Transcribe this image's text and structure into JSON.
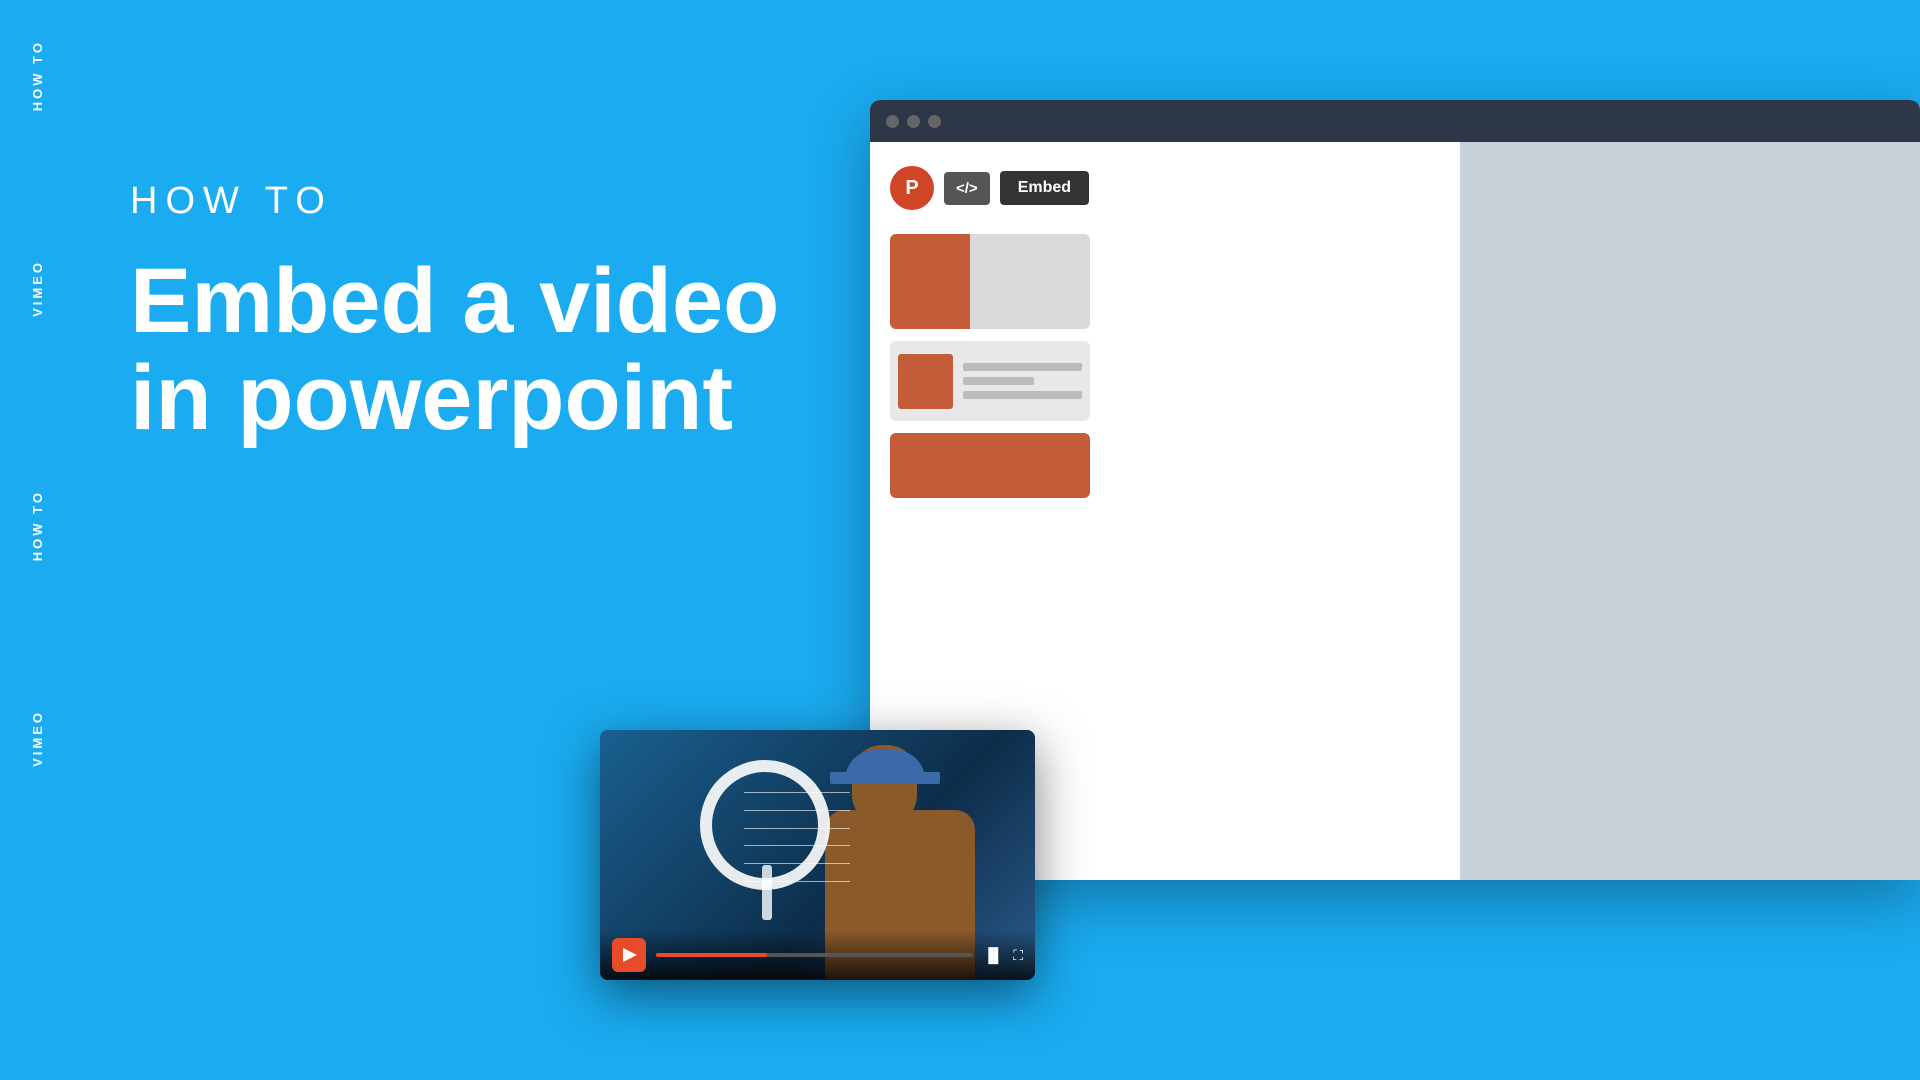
{
  "background_color": "#1aabf0",
  "vertical_labels": {
    "howto_top": "HOW TO",
    "vimeo_mid": "VIMEO",
    "howto_bot": "HOW TO",
    "vimeo_bot": "VIMEO"
  },
  "main_content": {
    "subtitle": "HOW TO",
    "title_line1": "Embed a video",
    "title_line2": "in powerpoint"
  },
  "browser": {
    "toolbar": {
      "powerpoint_icon_label": "P",
      "code_button_label": "</>",
      "embed_button_label": "Embed"
    }
  },
  "video_player": {
    "progress_percent": 35
  }
}
